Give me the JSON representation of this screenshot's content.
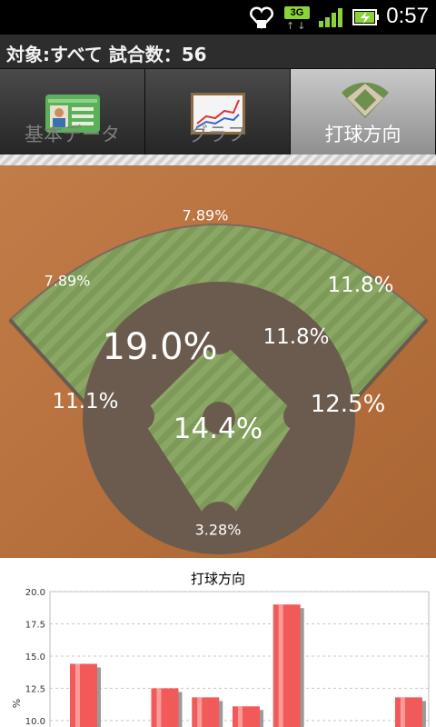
{
  "status_bar": {
    "time": "0:57",
    "network": "3G",
    "icons": [
      "heart-notification-icon",
      "signal-icon",
      "battery-charging-icon"
    ]
  },
  "header": {
    "title": "対象:すべて  試合数：56"
  },
  "tabs": [
    {
      "label": "基本データ",
      "icon": "profile-card-icon",
      "active": false
    },
    {
      "label": "グラフ",
      "icon": "line-chart-icon",
      "active": false
    },
    {
      "label": "打球方向",
      "icon": "baseball-field-icon",
      "active": true
    }
  ],
  "field": {
    "percentages": {
      "center_far": "7.89%",
      "left_far": "7.89%",
      "right_far": "11.8%",
      "left_center_infield": "19.0%",
      "right_center_infield": "11.8%",
      "third_base": "11.1%",
      "first_base": "12.5%",
      "pitcher": "14.4%",
      "catcher": "3.28%"
    },
    "colors": {
      "dirt": "#b9733f",
      "grass": "#8aa764",
      "infield_dirt": "#6b5b4e"
    }
  },
  "chart": {
    "title": "打球方向",
    "ylabel": "%"
  },
  "chart_data": {
    "type": "bar",
    "title": "打球方向",
    "ylabel": "%",
    "yticks": [
      10.0,
      12.5,
      15.0,
      17.5,
      20.0
    ],
    "ylim": [
      9.5,
      20.0
    ],
    "grid": true,
    "values": [
      14.4,
      12.5,
      11.8,
      11.1,
      19.0,
      11.8
    ],
    "bar_color": "#f25a5a"
  }
}
